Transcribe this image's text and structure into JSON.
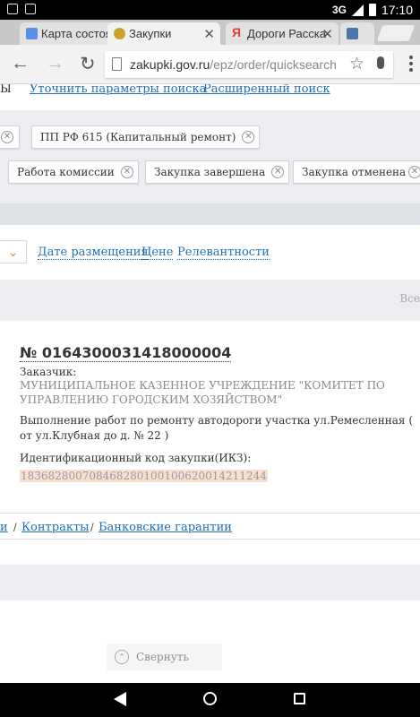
{
  "status_bar": {
    "network": "3G",
    "time": "17:10"
  },
  "tabs": [
    {
      "title": "Карта состоян",
      "favicon_color": "#5b8ee6"
    },
    {
      "title": "Закупки",
      "favicon_color": "#c9a227"
    },
    {
      "title": "Дороги Расска",
      "favicon_color": "#e53935"
    },
    {
      "title": "",
      "favicon_color": "#4a76a8"
    }
  ],
  "omnibox": {
    "domain": "zakupki.gov.ru",
    "path": "/epz/order/quicksearch"
  },
  "search_links": {
    "cut_text": "Ы",
    "refine": "Уточнить параметры поиска",
    "advanced": "Расширенный поиск"
  },
  "filter_chips": {
    "row1": [
      "ПП РФ 615 (Капитальный ремонт)"
    ],
    "row2": [
      "Работа комиссии",
      "Закупка завершена",
      "Закупка отменена"
    ]
  },
  "sort": {
    "options": [
      "Дате размещения",
      "Цене",
      "Релевантности"
    ]
  },
  "results_bar": {
    "cut_text": "Все"
  },
  "purchase": {
    "number": "№ 0164300031418000004",
    "customer_label": "Заказчик:",
    "customer_name": "МУНИЦИПАЛЬНОЕ КАЗЕННОЕ УЧРЕЖДЕНИЕ \"КОМИТЕТ ПО УПРАВЛЕНИЮ ГОРОДСКИМ ХОЗЯЙСТВОМ\"",
    "description": "Выполнение работ по ремонту автодороги участка ул.Ремесленная ( от ул.Клубная до д. № 22 )",
    "ikz_label": "Идентификационный код закупки(ИКЗ):",
    "ikz_value": "183682800708468280100100620014211244"
  },
  "section_tabs": {
    "cut_text": "и",
    "contracts": "Контракты",
    "guarantees": "Банковские гарантии"
  },
  "collapse": {
    "label": "Свернуть"
  },
  "colors": {
    "link": "#1f6fb8",
    "accent_orange": "#f07f3b",
    "band_grey": "#ebedf0",
    "ikz_highlight": "#f7dfd2"
  }
}
